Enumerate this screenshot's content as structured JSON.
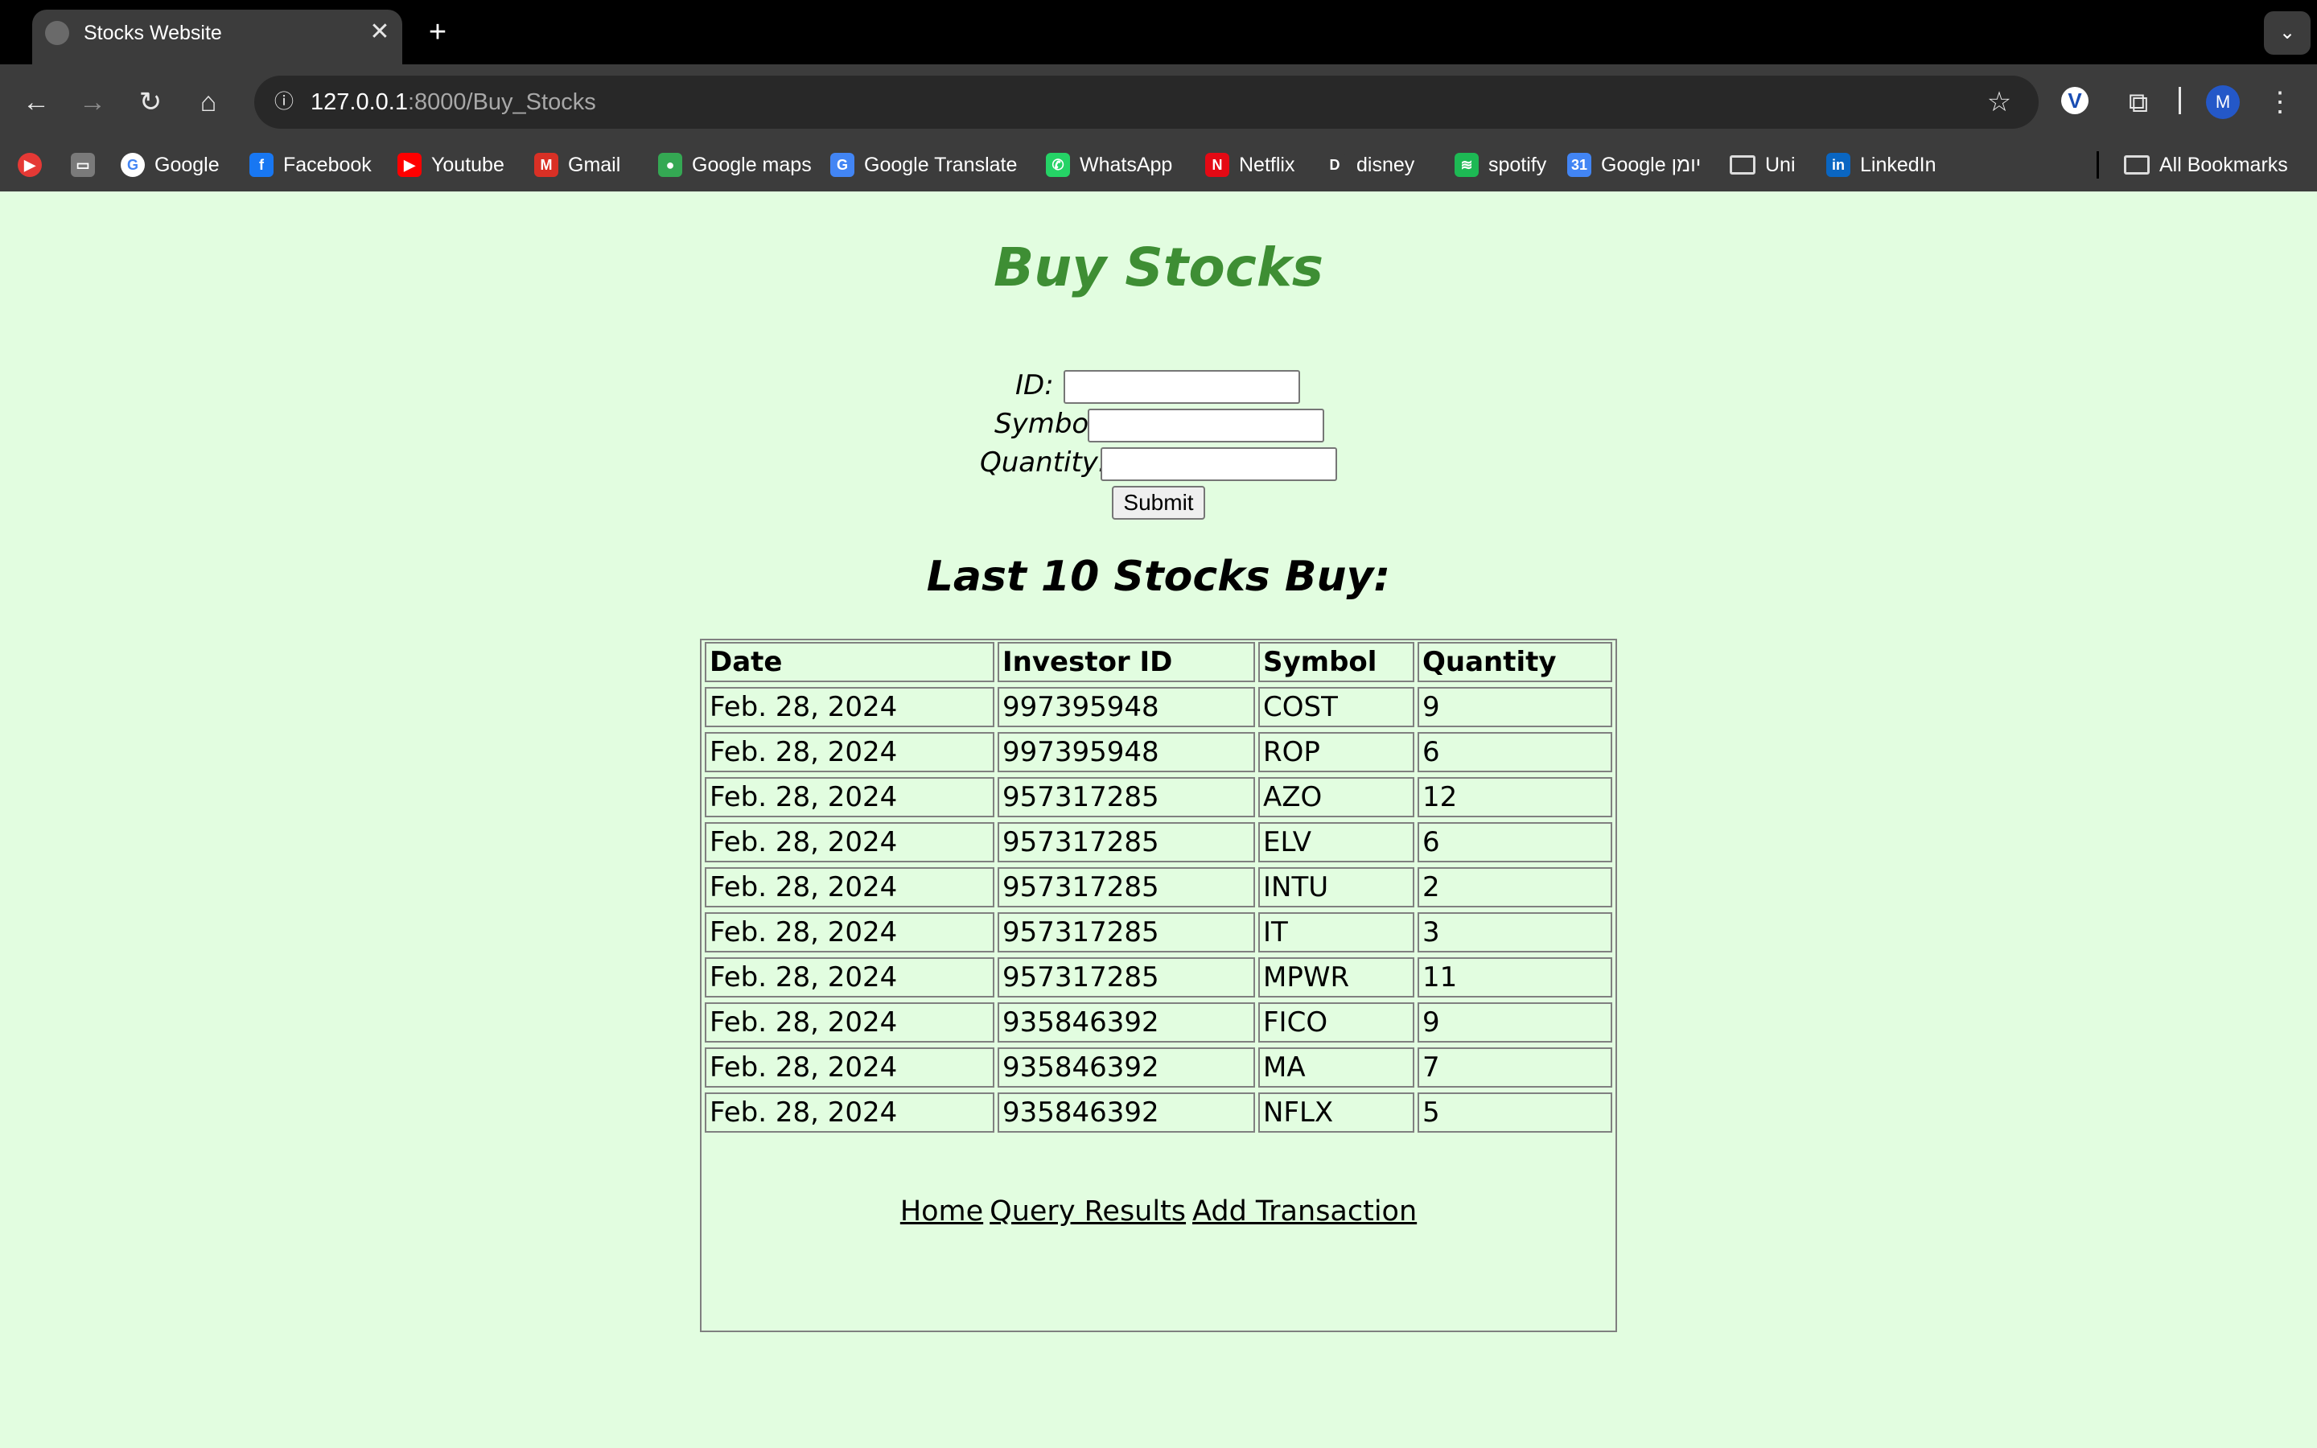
{
  "browser": {
    "tab": {
      "title": "Stocks Website"
    },
    "url": {
      "host": "127.0.0.1",
      "rest": ":8000/Buy_Stocks"
    },
    "profile_initial": "M",
    "bookmarks": [
      {
        "label": "",
        "icon": "youtube-music-icon",
        "color": "#e53935"
      },
      {
        "label": "",
        "icon": "app-icon",
        "color": "#7a7a7a"
      },
      {
        "label": "Google",
        "icon": "google-icon",
        "color": "#ffffff"
      },
      {
        "label": "Facebook",
        "icon": "facebook-icon",
        "color": "#1877f2"
      },
      {
        "label": "Youtube",
        "icon": "youtube-icon",
        "color": "#ff0000"
      },
      {
        "label": "Gmail",
        "icon": "gmail-icon",
        "color": "#d93025"
      },
      {
        "label": "Google maps",
        "icon": "maps-icon",
        "color": "#34a853"
      },
      {
        "label": "Google Translate",
        "icon": "translate-icon",
        "color": "#4285f4"
      },
      {
        "label": "WhatsApp",
        "icon": "whatsapp-icon",
        "color": "#25d366"
      },
      {
        "label": "Netflix",
        "icon": "netflix-icon",
        "color": "#e50914"
      },
      {
        "label": "disney",
        "icon": "disney-icon",
        "color": "#3c3c3c"
      },
      {
        "label": "spotify",
        "icon": "spotify-icon",
        "color": "#1db954"
      },
      {
        "label": "Google יומן",
        "icon": "calendar-icon",
        "color": "#4285f4"
      },
      {
        "label": "Uni",
        "icon": "folder-icon",
        "color": "#3c3c3c"
      },
      {
        "label": "LinkedIn",
        "icon": "linkedin-icon",
        "color": "#0a66c2"
      }
    ],
    "all_bookmarks": "All Bookmarks"
  },
  "page": {
    "title": "Buy Stocks",
    "form": {
      "id_label": "ID:",
      "symbol_label": "Symbol:",
      "quantity_label": "Quantity:",
      "submit": "Submit"
    },
    "table_title": "Last 10 Stocks Buy:",
    "table": {
      "headers": [
        "Date",
        "Investor ID",
        "Symbol",
        "Quantity"
      ],
      "rows": [
        [
          "Feb. 28, 2024",
          "997395948",
          "COST",
          "9"
        ],
        [
          "Feb. 28, 2024",
          "997395948",
          "ROP",
          "6"
        ],
        [
          "Feb. 28, 2024",
          "957317285",
          "AZO",
          "12"
        ],
        [
          "Feb. 28, 2024",
          "957317285",
          "ELV",
          "6"
        ],
        [
          "Feb. 28, 2024",
          "957317285",
          "INTU",
          "2"
        ],
        [
          "Feb. 28, 2024",
          "957317285",
          "IT",
          "3"
        ],
        [
          "Feb. 28, 2024",
          "957317285",
          "MPWR",
          "11"
        ],
        [
          "Feb. 28, 2024",
          "935846392",
          "FICO",
          "9"
        ],
        [
          "Feb. 28, 2024",
          "935846392",
          "MA",
          "7"
        ],
        [
          "Feb. 28, 2024",
          "935846392",
          "NFLX",
          "5"
        ]
      ]
    },
    "links": [
      "Home",
      "Query Results",
      "Add Transaction"
    ]
  }
}
